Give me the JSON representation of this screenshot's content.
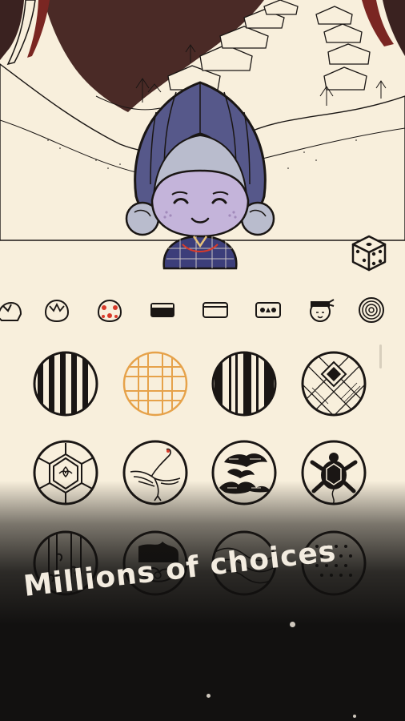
{
  "caption": {
    "text": "Millions of choices"
  },
  "colors": {
    "paper": "#f8efdc",
    "ink": "#1a1614",
    "night_sky": "#4a2a26",
    "hood": "#56588a",
    "face": "#c4b4da",
    "hair": "#b9bccd",
    "selected": "#e6a24a",
    "accent_red": "#d83a2a",
    "overlay": "#121110"
  },
  "character": {
    "icon": "grandma-avatar-icon"
  },
  "dice": {
    "icon": "dice-randomize-icon"
  },
  "categories": [
    {
      "icon": "hair-icon"
    },
    {
      "icon": "head-shape-icon"
    },
    {
      "icon": "hair-ornament-icon"
    },
    {
      "icon": "eyebrow-icon"
    },
    {
      "icon": "eyes-icon"
    },
    {
      "icon": "mouth-icon"
    },
    {
      "icon": "face-accessory-icon"
    },
    {
      "icon": "pattern-icon"
    }
  ],
  "patterns": [
    {
      "icon": "vertical-stripes-pattern-icon",
      "selected": false
    },
    {
      "icon": "lattice-grid-pattern-icon",
      "selected": true
    },
    {
      "icon": "mixed-stripes-pattern-icon",
      "selected": false
    },
    {
      "icon": "diagonal-diamond-pattern-icon",
      "selected": false
    },
    {
      "icon": "tortoiseshell-hexagon-pattern-icon",
      "selected": false
    },
    {
      "icon": "crane-pattern-icon",
      "selected": false
    },
    {
      "icon": "pine-cloud-pattern-icon",
      "selected": false
    },
    {
      "icon": "turtle-pattern-icon",
      "selected": false
    },
    {
      "icon": "bamboo-pattern-icon",
      "selected": false
    },
    {
      "icon": "flower-pattern-icon",
      "selected": false
    },
    {
      "icon": "wave-pattern-icon",
      "selected": false
    },
    {
      "icon": "dotted-pattern-icon",
      "selected": false
    }
  ]
}
